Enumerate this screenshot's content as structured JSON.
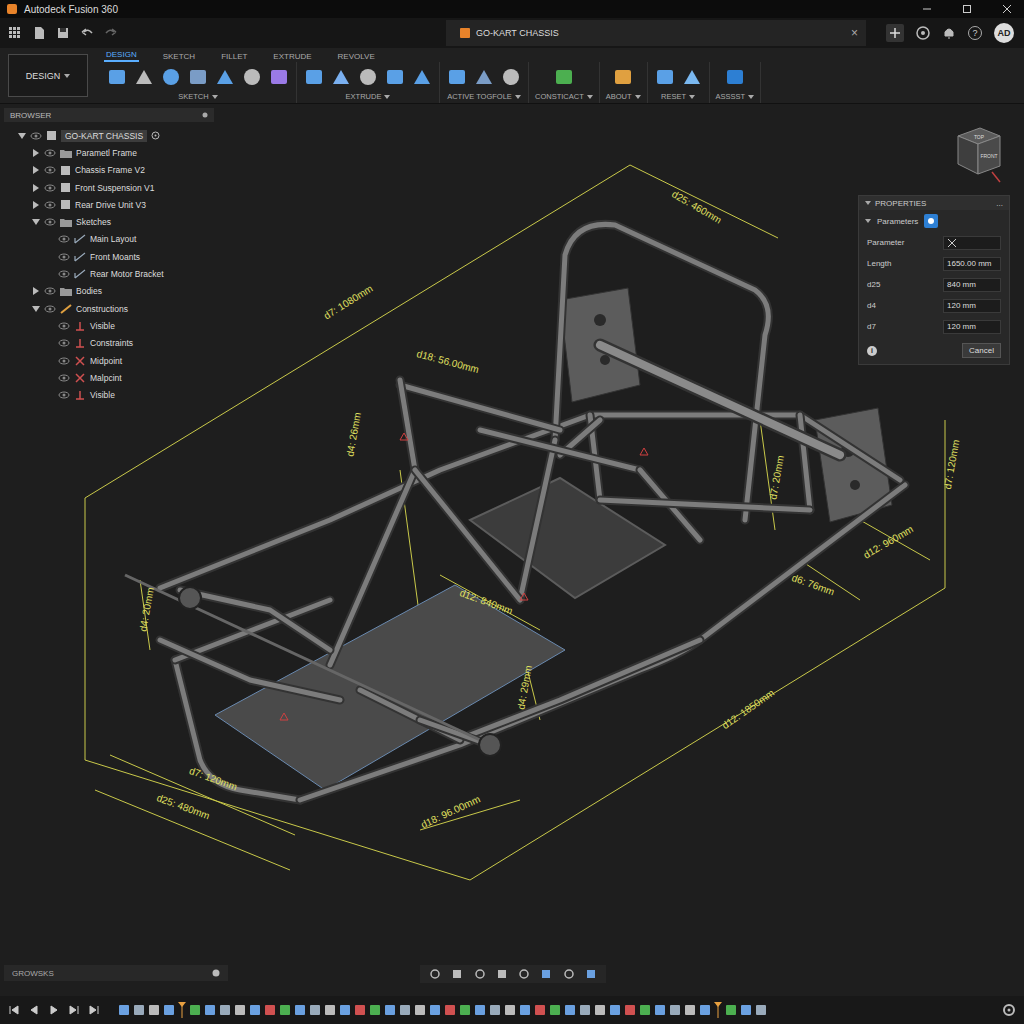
{
  "window": {
    "title": "Autodeck Fusion 360"
  },
  "document_tab": {
    "label": "GO-KART CHASSIS",
    "close": "×"
  },
  "header": {
    "help": "?",
    "initials": "AD"
  },
  "workspace": {
    "label": "DESIGN"
  },
  "toolbar": {
    "tabs": [
      {
        "label": "DESIGN",
        "selected": true
      },
      {
        "label": "SKETCH",
        "selected": false
      },
      {
        "label": "FILLET",
        "selected": false
      },
      {
        "label": "EXTRUDE",
        "selected": false
      },
      {
        "label": "REVOLVE",
        "selected": false
      }
    ],
    "groups": [
      {
        "label": "SKETCH"
      },
      {
        "label": "EXTRUDE"
      },
      {
        "label": "ACTIVE TOGFOLE"
      },
      {
        "label": "CONSTICACT"
      },
      {
        "label": "ABOUT"
      },
      {
        "label": "RESET"
      },
      {
        "label": "ASSSST"
      }
    ]
  },
  "browser": {
    "title": "BROWSER",
    "items": [
      {
        "label": "GO-KART CHASSIS",
        "kind": "root",
        "expandable": true,
        "expanded": true,
        "selected": true,
        "children": [
          {
            "label": "Parametl Frame",
            "kind": "folder",
            "expandable": true,
            "expanded": false,
            "selected": false,
            "children": []
          },
          {
            "label": "Chassis Frame V2",
            "kind": "component",
            "expandable": true,
            "expanded": false,
            "selected": false,
            "children": []
          },
          {
            "label": "Front Suspension V1",
            "kind": "component",
            "expandable": true,
            "expanded": false,
            "selected": false,
            "children": []
          },
          {
            "label": "Rear Drive Unit V3",
            "kind": "component",
            "expandable": true,
            "expanded": false,
            "selected": false,
            "children": []
          },
          {
            "label": "Sketches",
            "kind": "folder",
            "expandable": true,
            "expanded": true,
            "selected": false,
            "children": [
              {
                "label": "Main Layout",
                "kind": "sketch",
                "expandable": false,
                "selected": false,
                "children": []
              },
              {
                "label": "Front Moants",
                "kind": "sketch",
                "expandable": false,
                "selected": false,
                "children": []
              },
              {
                "label": "Rear Motor Bracket",
                "kind": "sketch",
                "expandable": false,
                "selected": false,
                "children": []
              }
            ]
          },
          {
            "label": "Bodies",
            "kind": "folder",
            "expandable": true,
            "expanded": false,
            "selected": false,
            "children": []
          },
          {
            "label": "Constructions",
            "kind": "construction",
            "expandable": true,
            "expanded": true,
            "selected": false,
            "children": [
              {
                "label": "Visible",
                "kind": "constraint",
                "expandable": false,
                "selected": false,
                "children": []
              },
              {
                "label": "Constraints",
                "kind": "constraint",
                "expandable": false,
                "selected": false,
                "children": []
              },
              {
                "label": "Midpoint",
                "kind": "point",
                "expandable": false,
                "selected": false,
                "children": []
              },
              {
                "label": "Malpcint",
                "kind": "point",
                "expandable": false,
                "selected": false,
                "children": []
              },
              {
                "label": "Visible",
                "kind": "constraint",
                "expandable": false,
                "selected": false,
                "children": []
              }
            ]
          }
        ]
      }
    ]
  },
  "canvas": {
    "dimensions": [
      "d25: 460mm",
      "d7: 1080mm",
      "d18: 56.00mm",
      "d4: 26mm",
      "d7: 20mm",
      "d7: 120mm",
      "d12: 960mm",
      "d6: 76mm",
      "d12: 840mm",
      "d4: 20mm",
      "d4: 29mm",
      "d12: 1850mm",
      "d7: 120mm",
      "d25: 480mm",
      "d18: 96.00mm"
    ],
    "view_cube": {
      "top": "TOP",
      "front": "FRONT"
    }
  },
  "properties": {
    "title": "PROPERTIES",
    "more": "...",
    "section": "Parameters",
    "header": "Parameter",
    "rows": [
      {
        "name": "Length",
        "value": "1650.00 mm"
      },
      {
        "name": "d25",
        "value": "840 mm"
      },
      {
        "name": "d4",
        "value": "120 mm"
      },
      {
        "name": "d7",
        "value": "120 mm"
      }
    ],
    "info": "i",
    "cancel": "Cancel"
  },
  "bottom_panel": {
    "label": "GROWSKS"
  }
}
